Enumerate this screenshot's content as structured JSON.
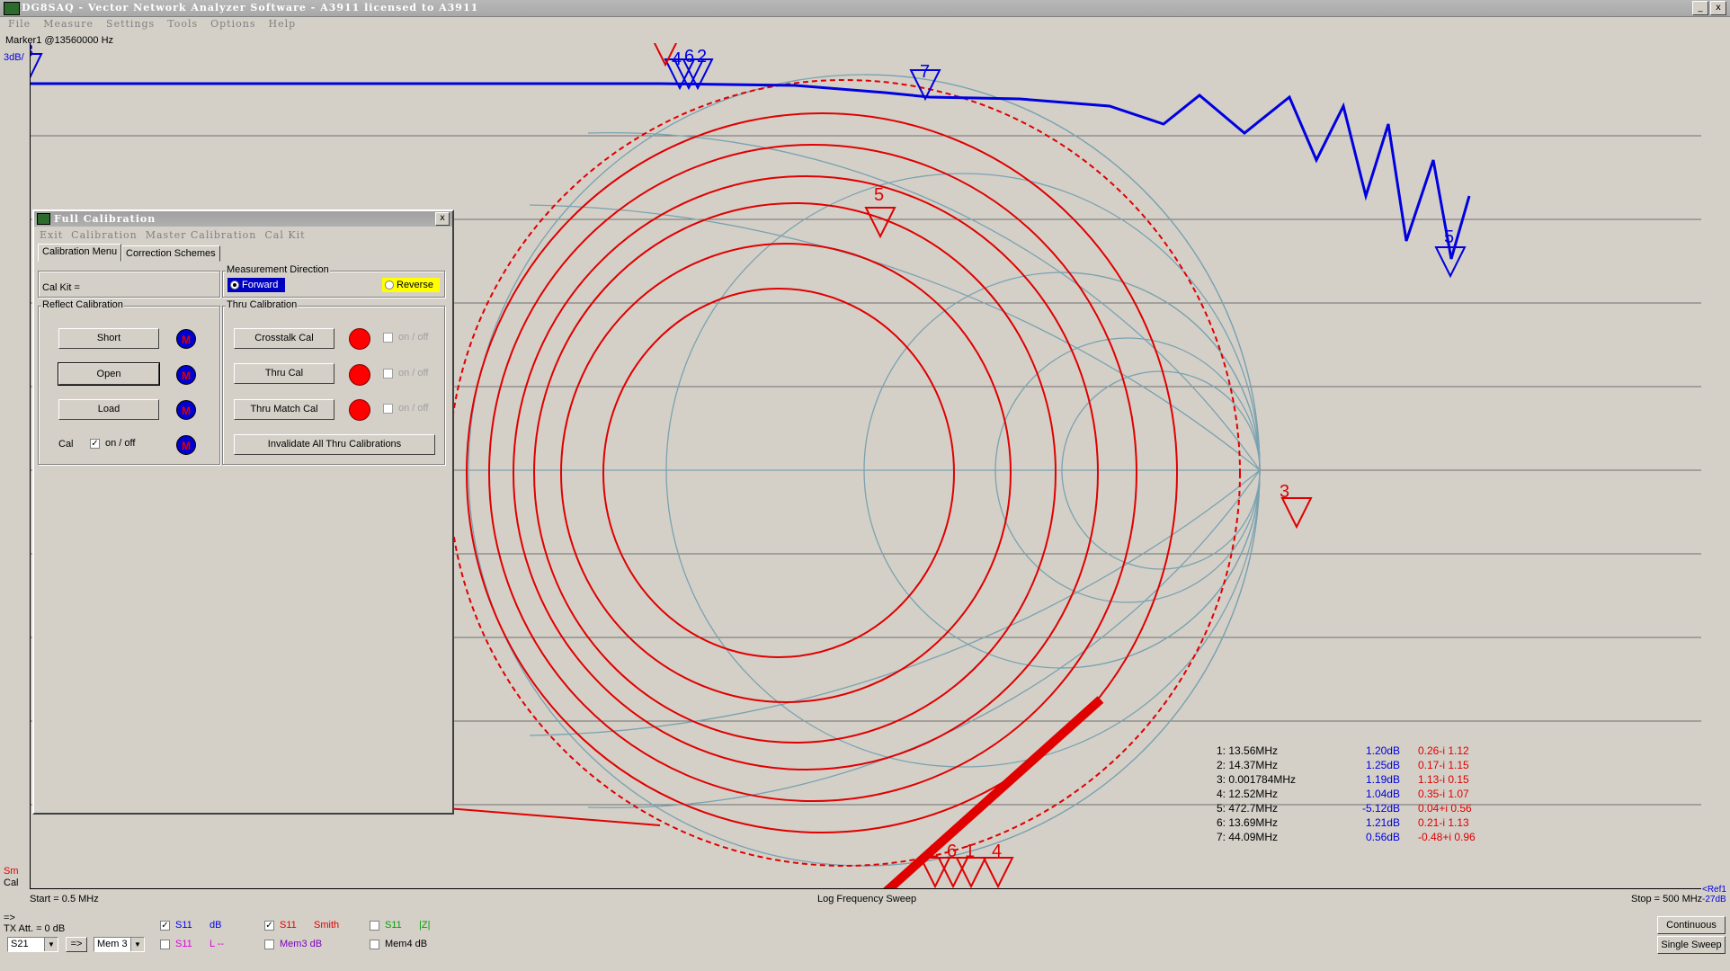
{
  "window": {
    "title": "DG8SAQ  -  Vector Network Analyzer Software  - A3911 licensed to A3911",
    "minimize_glyph": "_",
    "close_glyph": "x"
  },
  "menu": [
    "File",
    "Measure",
    "Settings",
    "Tools",
    "Options",
    "Help"
  ],
  "marker_info": "Marker1 @13560000 Hz",
  "scale_label": "3dB/",
  "trace_labels": {
    "sm": "Sm",
    "cal": "Cal"
  },
  "sweep": {
    "start": "Start = 0.5 MHz",
    "mode": "Log Frequency Sweep",
    "stop": "Stop = 500 MHz",
    "ref_line1": "<Ref1",
    "ref_line2": "-27dB"
  },
  "bottom_left": {
    "arrow": "=>",
    "tx_att": "TX Att.  = 0 dB",
    "port_select": "S21",
    "arrow_btn": "=>",
    "mem_select": "Mem 3"
  },
  "trace_checkboxes": [
    {
      "checked": "✓",
      "param": "S11",
      "format": "dB",
      "param_color": "#0000e0",
      "format_color": "#0000e0"
    },
    {
      "checked": "",
      "param": "S11",
      "format": "L --",
      "param_color": "#e000e0",
      "format_color": "#e000e0"
    },
    {
      "checked": "✓",
      "param": "S11",
      "format": "Smith",
      "param_color": "#e00000",
      "format_color": "#e00000"
    },
    {
      "checked": "",
      "param": "Mem3 dB",
      "format": "",
      "param_color": "#8000c0",
      "format_color": "#8000c0"
    },
    {
      "checked": "",
      "param": "S11",
      "format": "|Z|",
      "param_color": "#00a000",
      "format_color": "#00a000"
    },
    {
      "checked": "",
      "param": "Mem4 dB",
      "format": "",
      "param_color": "#000000",
      "format_color": "#000000"
    }
  ],
  "sweep_buttons": {
    "continuous": "Continuous",
    "single": "Single Sweep"
  },
  "markers": [
    {
      "freq": "1: 13.56MHz",
      "db": "1.20dB",
      "z": "0.26-i 1.12"
    },
    {
      "freq": "2: 14.37MHz",
      "db": "1.25dB",
      "z": "0.17-i 1.15"
    },
    {
      "freq": "3: 0.001784MHz",
      "db": "1.19dB",
      "z": "1.13-i 0.15"
    },
    {
      "freq": "4: 12.52MHz",
      "db": "1.04dB",
      "z": "0.35-i 1.07"
    },
    {
      "freq": "5: 472.7MHz",
      "db": "-5.12dB",
      "z": "0.04+i 0.56"
    },
    {
      "freq": "6: 13.69MHz",
      "db": "1.21dB",
      "z": "0.21-i 1.13"
    },
    {
      "freq": "7: 44.09MHz",
      "db": "0.56dB",
      "z": "-0.48+i 0.96"
    }
  ],
  "plot_marker_ids": [
    "3",
    "4",
    "6",
    "2",
    "7",
    "5",
    "3",
    "2",
    "6",
    "1",
    "4",
    "5"
  ],
  "dialog": {
    "title": "Full Calibration",
    "close_glyph": "x",
    "menu": [
      "Exit",
      "Calibration",
      "Master Calibration",
      "Cal Kit"
    ],
    "tabs": [
      "Calibration Menu",
      "Correction Schemes"
    ],
    "cal_kit_label": "Cal Kit =",
    "direction_group": "Measurement Direction",
    "forward": "Forward",
    "reverse": "Reverse",
    "reflect_group": "Reflect Calibration",
    "thru_group": "Thru Calibration",
    "short": "Short",
    "open": "Open",
    "load": "Load",
    "cal_label": "Cal",
    "on_off": "on / off",
    "m_glyph": "M",
    "crosstalk": "Crosstalk Cal",
    "thru": "Thru Cal",
    "thru_match": "Thru Match Cal",
    "invalidate": "Invalidate All Thru Calibrations",
    "cal_checked": "✓"
  }
}
